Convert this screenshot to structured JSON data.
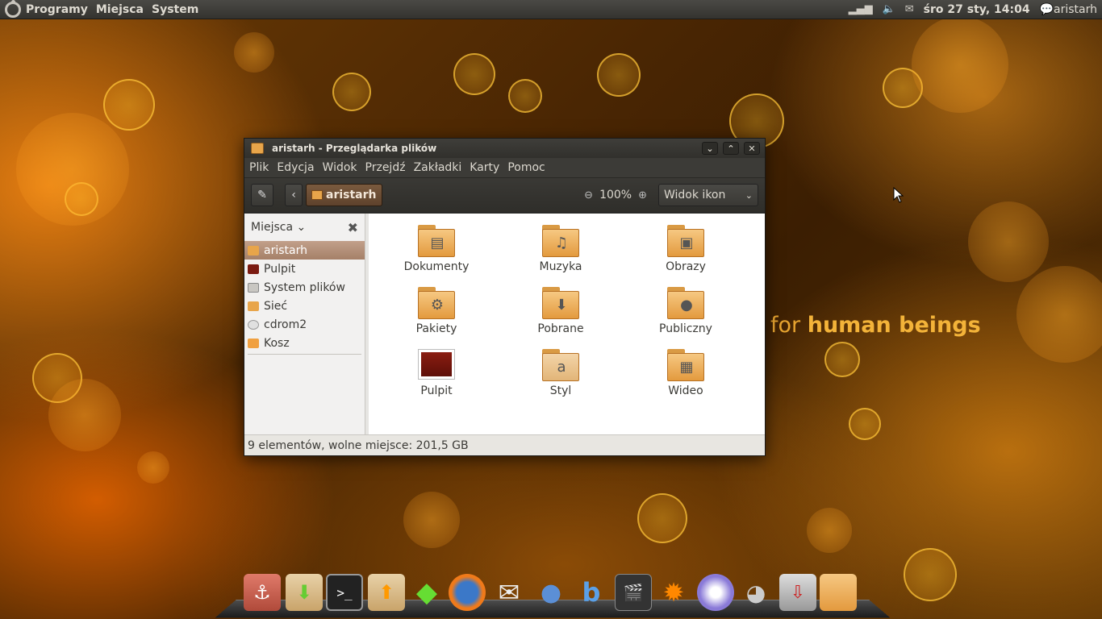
{
  "top_panel": {
    "menus": [
      "Programy",
      "Miejsca",
      "System"
    ],
    "clock": "śro 27 sty, 14:04",
    "user": "aristarh"
  },
  "wallpaper": {
    "tagline_prefix": "for ",
    "tagline_bold": "human beings"
  },
  "window": {
    "title": "aristarh - Przeglądarka plików",
    "controls": [
      "minimize",
      "maximize",
      "close"
    ],
    "menubar": [
      "Plik",
      "Edycja",
      "Widok",
      "Przejdź",
      "Zakładki",
      "Karty",
      "Pomoc"
    ],
    "toolbar": {
      "breadcrumb": "aristarh",
      "zoom_level": "100%",
      "view_mode": "Widok ikon"
    },
    "sidebar": {
      "header": "Miejsca",
      "items": [
        {
          "label": "aristarh",
          "icon": "home-folder-icon",
          "active": true
        },
        {
          "label": "Pulpit",
          "icon": "desktop-icon",
          "active": false
        },
        {
          "label": "System plików",
          "icon": "harddisk-icon",
          "active": false
        },
        {
          "label": "Sieć",
          "icon": "network-icon",
          "active": false
        },
        {
          "label": "cdrom2",
          "icon": "cdrom-icon",
          "active": false
        },
        {
          "label": "Kosz",
          "icon": "trash-icon",
          "active": false
        }
      ]
    },
    "files": [
      {
        "label": "Dokumenty",
        "icon": "documents-folder-icon"
      },
      {
        "label": "Muzyka",
        "icon": "music-folder-icon"
      },
      {
        "label": "Obrazy",
        "icon": "pictures-folder-icon"
      },
      {
        "label": "Pakiety",
        "icon": "packages-folder-icon"
      },
      {
        "label": "Pobrane",
        "icon": "downloads-folder-icon"
      },
      {
        "label": "Publiczny",
        "icon": "public-folder-icon"
      },
      {
        "label": "Pulpit",
        "icon": "desktop-folder-icon"
      },
      {
        "label": "Styl",
        "icon": "style-folder-icon"
      },
      {
        "label": "Wideo",
        "icon": "videos-folder-icon"
      }
    ],
    "statusbar": "9 elementów, wolne miejsce: 201,5 GB"
  },
  "dock": {
    "items": [
      "anchor-icon",
      "download-box-icon",
      "terminal-icon",
      "upload-box-icon",
      "emerald-icon",
      "firefox-icon",
      "mail-icon",
      "pidgin-icon",
      "blueman-icon",
      "video-editor-icon",
      "flame-icon",
      "aperture-icon",
      "gimp-icon",
      "usb-creator-icon",
      "folder-icon"
    ]
  },
  "colors": {
    "panel": "#3c3b37",
    "accent": "#e39a3e",
    "selection": "#a58068"
  }
}
